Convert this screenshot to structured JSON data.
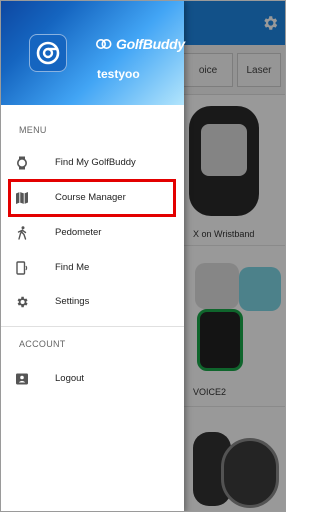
{
  "background": {
    "tabs": [
      {
        "label": "oice"
      },
      {
        "label": "Laser"
      }
    ],
    "cards": [
      {
        "caption": "X on Wristband"
      },
      {
        "caption": "VOICE2"
      }
    ]
  },
  "drawer": {
    "brand_logo_text": "GolfBuddy",
    "username": "testyoo",
    "sections": {
      "menu": {
        "label": "MENU",
        "items": [
          {
            "label": "Find My GolfBuddy",
            "icon": "watch-icon"
          },
          {
            "label": "Course Manager",
            "icon": "map-icon",
            "highlighted": true
          },
          {
            "label": "Pedometer",
            "icon": "walking-icon"
          },
          {
            "label": "Find Me",
            "icon": "phone-signal-icon"
          },
          {
            "label": "Settings",
            "icon": "gear-icon"
          }
        ]
      },
      "account": {
        "label": "ACCOUNT",
        "items": [
          {
            "label": "Logout",
            "icon": "id-card-icon"
          }
        ]
      }
    }
  },
  "colors": {
    "highlight": "#e30000",
    "toolbar": "#1e88e5"
  }
}
